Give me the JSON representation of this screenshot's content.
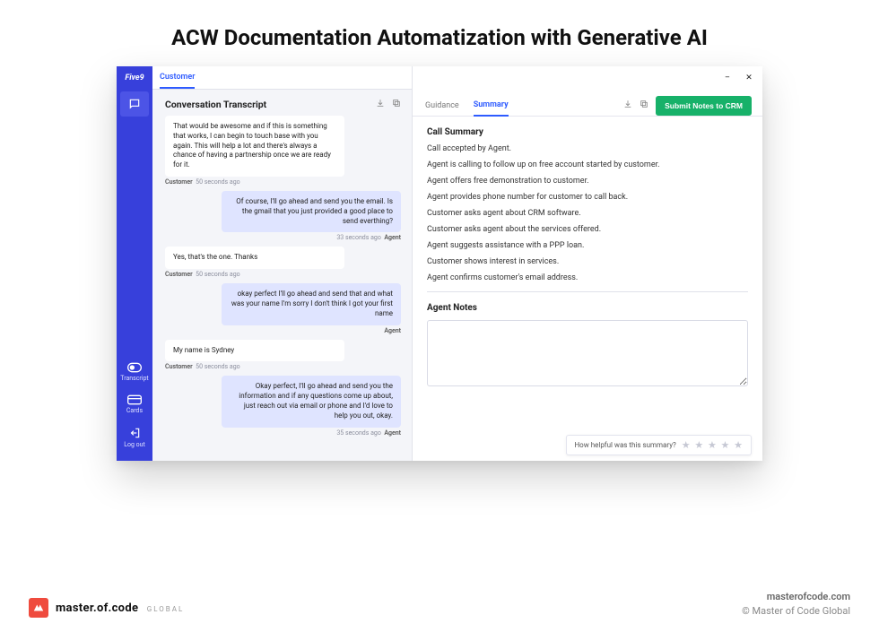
{
  "page": {
    "title": "ACW Documentation Automatization with Generative AI"
  },
  "app": {
    "logo_text": "Five9",
    "header_tab": "Customer",
    "window": {
      "minimize": "–",
      "close": "✕"
    }
  },
  "sidebar": {
    "items": [
      {
        "id": "transcript",
        "label": "Transcript"
      },
      {
        "id": "cards",
        "label": "Cards"
      },
      {
        "id": "logout",
        "label": "Log out"
      }
    ]
  },
  "transcript": {
    "title": "Conversation Transcript",
    "download_icon": "download",
    "copy_icon": "copy",
    "messages": [
      {
        "role": "customer",
        "text": "That would be awesome and if this is something that works, I can begin to touch base with you again. This will help a lot and there's always a chance of having a partnership once we are ready for it.",
        "who": "Customer",
        "time": "50 seconds ago"
      },
      {
        "role": "agent",
        "text": "Of course, I'll go ahead and send you the email. Is the gmail that you just provided a good place to send everthing?",
        "who": "Agent",
        "time": "33 seconds ago"
      },
      {
        "role": "customer",
        "text": "Yes, that's the one. Thanks",
        "who": "Customer",
        "time": "50 seconds ago"
      },
      {
        "role": "agent",
        "text": "okay perfect I'll go ahead and send that and what was your name I'm sorry I don't think I got your first name",
        "who": "Agent",
        "time": ""
      },
      {
        "role": "customer",
        "text": "My name is Sydney",
        "who": "Customer",
        "time": "50 seconds ago"
      },
      {
        "role": "agent",
        "text": "Okay perfect, I'll go ahead and send you the information and if any questions come up about, just reach out via email or phone and I'd love to help you out, okay.",
        "who": "Agent",
        "time": "35 seconds ago"
      }
    ]
  },
  "panel": {
    "tabs": {
      "guidance": "Guidance",
      "summary": "Summary"
    },
    "active_tab": "summary",
    "actions": {
      "download": "download",
      "copy": "copy",
      "submit_label": "Submit Notes to CRM"
    },
    "summary_heading": "Call Summary",
    "summary_lines": [
      "Call accepted by Agent.",
      "Agent is calling to follow up on free account started by customer.",
      "Agent offers free demonstration to customer.",
      "Agent provides phone number for customer to call back.",
      "Customer asks agent about CRM software.",
      "Customer asks agent about the services offered.",
      "Agent suggests assistance with a PPP loan.",
      "Customer shows interest in services.",
      "Agent confirms customer's email address."
    ],
    "notes_heading": "Agent Notes",
    "rating_prompt": "How helpful was this summary?",
    "stars": "★ ★ ★ ★ ★"
  },
  "footer": {
    "brand": "master.of.code",
    "brand_sub": "GLOBAL",
    "site": "masterofcode.com",
    "copyright": "© Master of Code Global"
  }
}
